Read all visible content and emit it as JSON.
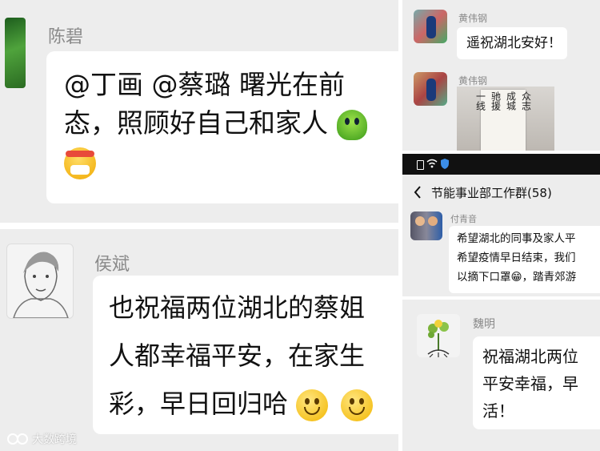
{
  "panels": {
    "top_left": {
      "sender": "陈碧",
      "message_lines": [
        "@丁画  @蔡璐  曙光在前",
        "态，照顾好自己和家人"
      ],
      "emojis": [
        "green-alien-emoji",
        "mask-bandage-emoji"
      ]
    },
    "bottom_left": {
      "sender": "侯斌",
      "message_lines": [
        "也祝福两位湖北的蔡姐",
        "人都幸福平安，在家生",
        "彩，早日回归哈"
      ],
      "emojis": [
        "smile-emoji",
        "smile-emoji"
      ]
    },
    "top_right": {
      "messages": [
        {
          "sender": "黄伟钢",
          "text": "遥祝湖北安好！"
        },
        {
          "sender": "黄伟钢",
          "image_text_cols": [
            "众志",
            "成城",
            "驰援",
            "一线"
          ]
        }
      ]
    },
    "right_middle": {
      "status_icons": [
        "sim-icon",
        "wifi-icon",
        "shield-icon"
      ],
      "group_title": "节能事业部工作群(58)",
      "sender": "付青音",
      "message_lines": [
        "希望湖北的同事及家人平",
        "希望疫情早日结束，我们",
        "以摘下口罩😁，踏青郊游"
      ]
    },
    "right_bottom": {
      "sender": "魏明",
      "message_lines": [
        "祝福湖北两位",
        "平安幸福，早",
        "活！"
      ]
    }
  },
  "watermark": "大数跨境",
  "colors": {
    "chat_bg": "#ededed",
    "bubble": "#ffffff",
    "name": "#8a8a8a"
  }
}
